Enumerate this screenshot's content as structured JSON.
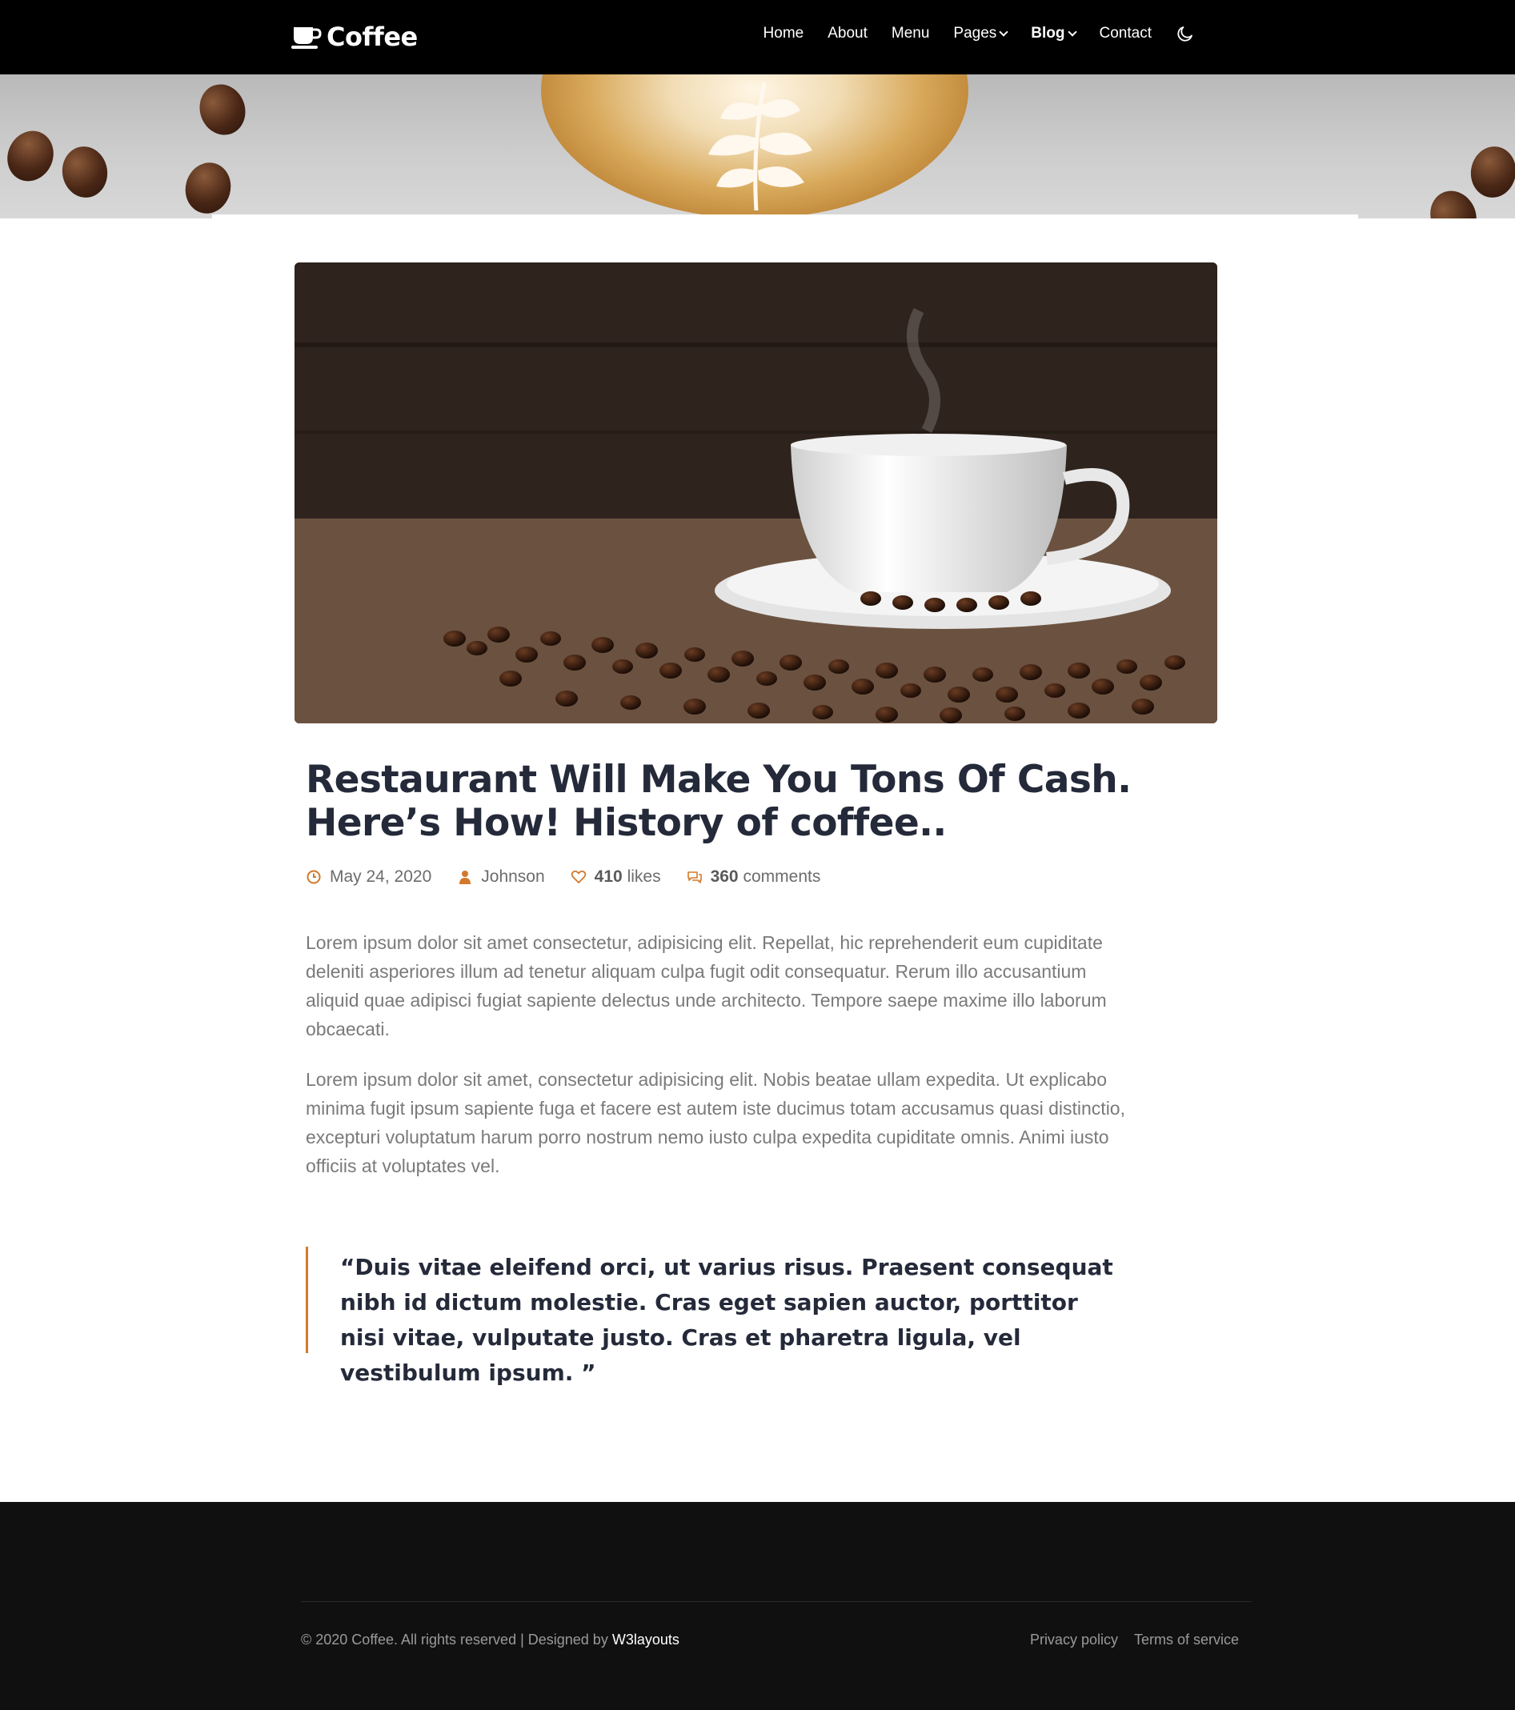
{
  "brand": {
    "name": "Coffee",
    "logo_icon": "coffee-cup-icon"
  },
  "nav": {
    "items": [
      {
        "label": "Home",
        "dropdown": false,
        "active": false
      },
      {
        "label": "About",
        "dropdown": false,
        "active": false
      },
      {
        "label": "Menu",
        "dropdown": false,
        "active": false
      },
      {
        "label": "Pages",
        "dropdown": true,
        "active": false
      },
      {
        "label": "Blog",
        "dropdown": true,
        "active": true
      },
      {
        "label": "Contact",
        "dropdown": false,
        "active": false
      }
    ],
    "theme_toggle_icon": "moon-icon"
  },
  "article": {
    "title": "Restaurant Will Make You Tons Of Cash. Here’s How! History of coffee..",
    "meta": {
      "date": "May 24, 2020",
      "author": "Johnson",
      "likes_count": "410",
      "likes_label": "likes",
      "comments_count": "360",
      "comments_label": "comments"
    },
    "paragraphs": [
      "Lorem ipsum dolor sit amet consectetur, adipisicing elit. Repellat, hic reprehenderit eum cupiditate deleniti asperiores illum ad tenetur aliquam culpa fugit odit consequatur. Rerum illo accusantium aliquid quae adipisci fugiat sapiente delectus unde architecto. Tempore saepe maxime illo laborum obcaecati.",
      "Lorem ipsum dolor sit amet, consectetur adipisicing elit. Nobis beatae ullam expedita. Ut explicabo minima fugit ipsum sapiente fuga et facere est autem iste ducimus totam accusamus quasi distinctio, excepturi voluptatum harum porro nostrum nemo iusto culpa expedita cupiditate omnis. Animi iusto officiis at voluptates vel."
    ],
    "quote": "“Duis vitae eleifend orci, ut varius risus. Praesent consequat nibh id dictum molestie. Cras eget sapien auctor, porttitor nisi vitae, vulputate justo. Cras et pharetra ligula, vel vestibulum ipsum. ”"
  },
  "footer": {
    "copyright": "© 2020 Coffee. All rights reserved | Designed by",
    "designer": "W3layouts",
    "links": [
      "Privacy policy",
      "Terms of service"
    ]
  },
  "colors": {
    "accent": "#d3792b",
    "nav_bg": "#000000",
    "footer_bg": "#101010",
    "title": "#252a3a"
  }
}
